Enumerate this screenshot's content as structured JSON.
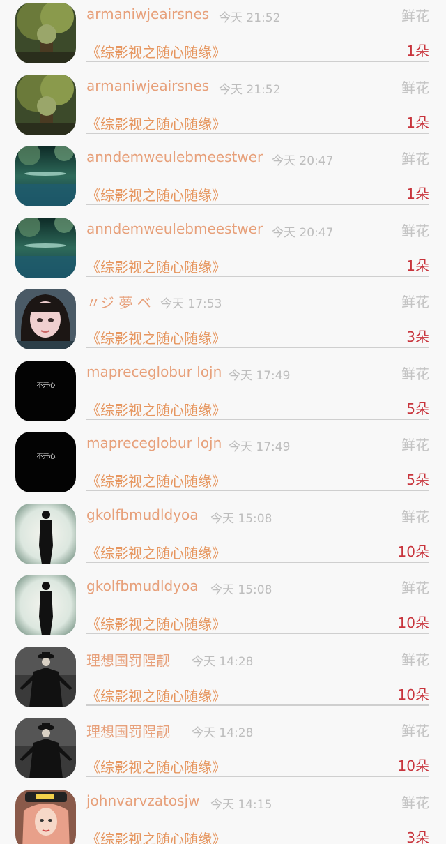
{
  "list": {
    "gift_label": "鲜花",
    "rows": [
      {
        "name": "armaniwjeairsnes",
        "time": "今天 21:52",
        "title": "《综影视之随心随缘》",
        "count": "1朵",
        "avatar": "tree-avatar"
      },
      {
        "name": "armaniwjeairsnes",
        "time": "今天 21:52",
        "title": "《综影视之随心随缘》",
        "count": "1朵",
        "avatar": "tree-avatar"
      },
      {
        "name": "anndemweulebmeestwer",
        "time": "今天 20:47",
        "title": "《综影视之随心随缘》",
        "count": "1朵",
        "avatar": "lake-avatar"
      },
      {
        "name": "anndemweulebmeestwer",
        "time": "今天 20:47",
        "title": "《综影视之随心随缘》",
        "count": "1朵",
        "avatar": "lake-avatar"
      },
      {
        "name": "〃ジ 夢 ベ",
        "time": "今天 17:53",
        "title": "《综影视之随心随缘》",
        "count": "3朵",
        "avatar": "girl-avatar"
      },
      {
        "name": "mapreceglobur lojn",
        "time": "今天 17:49",
        "title": "《综影视之随心随缘》",
        "count": "5朵",
        "avatar": "black-text-avatar"
      },
      {
        "name": "mapreceglobur lojn",
        "time": "今天 17:49",
        "title": "《综影视之随心随缘》",
        "count": "5朵",
        "avatar": "black-text-avatar"
      },
      {
        "name": "gkolfbmudldyoa",
        "time": "今天 15:08",
        "title": "《综影视之随心随缘》",
        "count": "10朵",
        "avatar": "silhouette-avatar"
      },
      {
        "name": "gkolfbmudldyoa",
        "time": "今天 15:08",
        "title": "《综影视之随心随缘》",
        "count": "10朵",
        "avatar": "silhouette-avatar"
      },
      {
        "name": "理想国罚陧靓",
        "time": "今天 14:28",
        "title": "《综影视之随心随缘》",
        "count": "10朵",
        "avatar": "dark-figure-avatar"
      },
      {
        "name": "理想国罚陧靓",
        "time": "今天 14:28",
        "title": "《综影视之随心随缘》",
        "count": "10朵",
        "avatar": "dark-figure-avatar"
      },
      {
        "name": "johnvarvzatosjw",
        "time": "今天 14:15",
        "title": "《综影视之随心随缘》",
        "count": "3朵",
        "avatar": "pink-hair-avatar"
      }
    ],
    "avatar_text": "不开心"
  }
}
